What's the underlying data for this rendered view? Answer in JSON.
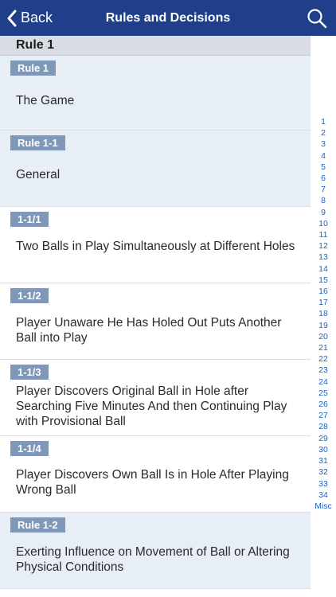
{
  "nav": {
    "back_label": "Back",
    "title": "Rules and Decisions",
    "back_icon": "chevron-left-icon",
    "search_icon": "search-icon"
  },
  "section": {
    "title": "Rule 1"
  },
  "rows": [
    {
      "type": "rule",
      "badge": "Rule 1",
      "title": "The Game"
    },
    {
      "type": "rule",
      "badge": "Rule 1-1",
      "title": "General"
    },
    {
      "type": "decision",
      "badge": "1-1/1",
      "title": "Two Balls in Play Simultaneously at Different Holes"
    },
    {
      "type": "decision",
      "badge": "1-1/2",
      "title": "Player Unaware He Has Holed Out Puts Another Ball into Play"
    },
    {
      "type": "decision",
      "badge": "1-1/3",
      "title": "Player Discovers Original Ball in Hole after Searching Five Minutes And then Continuing Play with Provisional Ball"
    },
    {
      "type": "decision",
      "badge": "1-1/4",
      "title": "Player Discovers Own Ball Is in Hole After Playing Wrong Ball"
    },
    {
      "type": "rule",
      "badge": "Rule 1-2",
      "title": "Exerting Influence on Movement of Ball or Altering Physical Conditions"
    }
  ],
  "index": [
    "1",
    "2",
    "3",
    "4",
    "5",
    "6",
    "7",
    "8",
    "9",
    "10",
    "11",
    "12",
    "13",
    "14",
    "15",
    "16",
    "17",
    "18",
    "19",
    "20",
    "21",
    "22",
    "23",
    "24",
    "25",
    "26",
    "27",
    "28",
    "29",
    "30",
    "31",
    "32",
    "33",
    "34",
    "Misc"
  ],
  "colors": {
    "navbar": "#1f3f8a",
    "badge": "#7f98b8",
    "rule_row_bg": "#e8eef6",
    "index_link": "#1a63c7"
  }
}
